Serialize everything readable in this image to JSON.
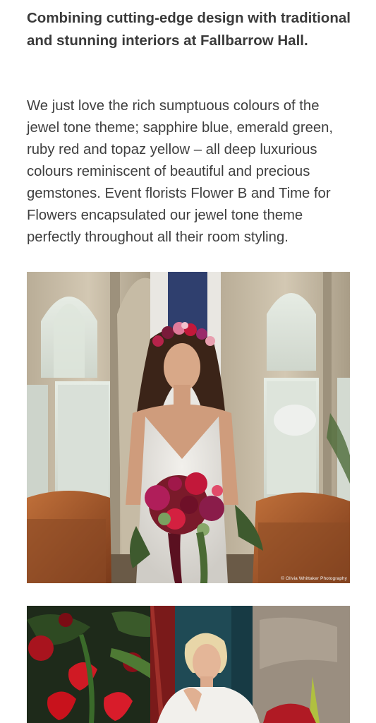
{
  "article": {
    "heading": "Combining cutting-edge design with traditional and stunning interiors at Fallbarrow Hall.",
    "body": "We just love the rich sumptuous colours of the jewel tone theme; sapphire blue, emerald green, ruby red and topaz yellow – all deep luxurious colours reminiscent of beautiful and precious gemstones. Event florists Flower B and Time for Flowers encapsulated our jewel tone theme perfectly throughout all their room styling."
  },
  "photos": [
    {
      "subject": "bride-with-jewel-tone-bouquet",
      "credit": "© Olivia Whittaker Photography"
    },
    {
      "subject": "bride-seated-with-red-florals"
    }
  ],
  "colors": {
    "text": "#3a3a3a",
    "background": "#ffffff",
    "sapphire": "#2f3f6e",
    "ruby": "#c2183a",
    "leather": "#a0522d"
  }
}
